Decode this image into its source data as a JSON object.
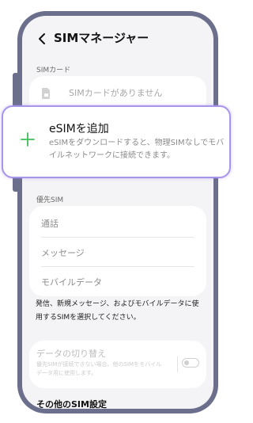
{
  "header": {
    "title": "SIMマネージャー"
  },
  "sim_cards": {
    "section_label": "SIMカード",
    "no_sim_text": "SIMカードがありません"
  },
  "add_esim": {
    "title": "eSIMを追加",
    "description": "eSIMをダウンロードすると、物理SIMなしでモバイルネットワークに接続できます。"
  },
  "preferred_sim": {
    "section_label": "優先SIM",
    "items": [
      {
        "label": "通話"
      },
      {
        "label": "メッセージ"
      },
      {
        "label": "モバイルデータ"
      }
    ],
    "footnote": "発信、新規メッセージ、およびモバイルデータに使用するSIMを選択してください。"
  },
  "data_switching": {
    "title": "データの切り替え",
    "description": "優先SIMが接続できない場合、他のSIMをモバイルデータ用に使用します。",
    "enabled": false
  },
  "other_settings": {
    "label": "その他のSIM設定"
  },
  "colors": {
    "accent_green": "#3fbf5a",
    "highlight_border": "#a894ea",
    "frame": "#6b6f8c"
  }
}
